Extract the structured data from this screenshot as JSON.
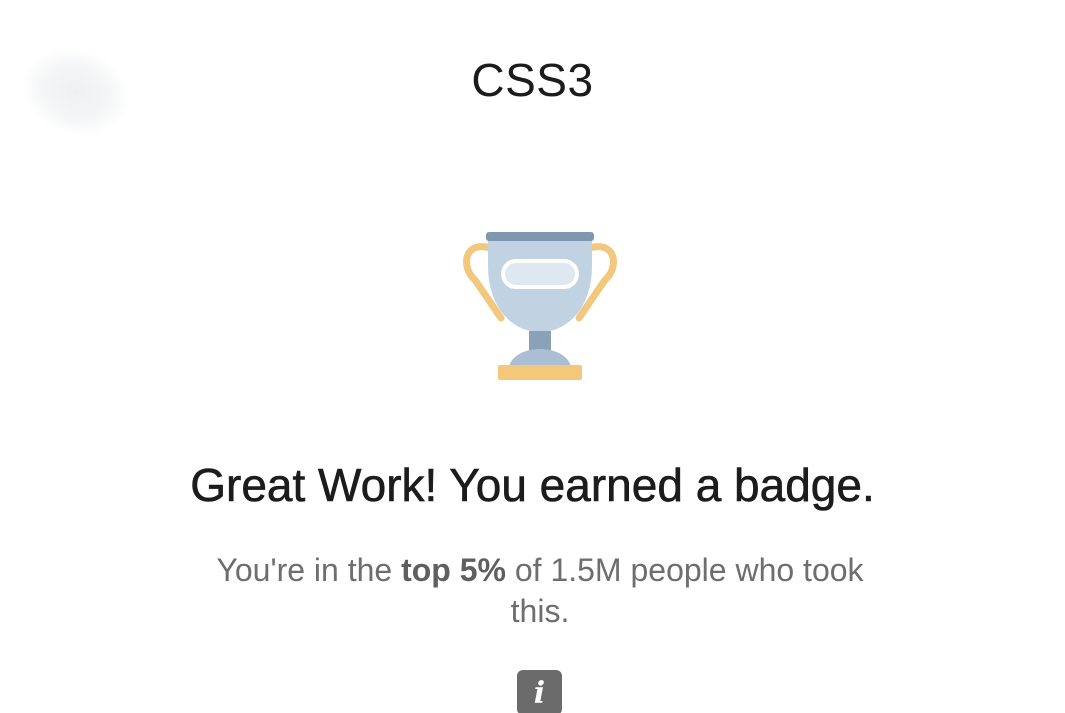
{
  "header": {
    "title": "CSS3"
  },
  "badge": {
    "icon": "trophy-icon",
    "colors": {
      "cup": "#c1d2e3",
      "rim": "#7f98b0",
      "handles": "#f2c77e",
      "base": "#f5c77a",
      "stem": "#8aa2b8"
    }
  },
  "result": {
    "headline": "Great Work! You earned a badge.",
    "sub_prefix": "You're in the ",
    "sub_highlight": "top 5%",
    "sub_suffix": " of 1.5M people who took this."
  },
  "info_button": {
    "icon": "info-icon",
    "glyph": "i"
  }
}
